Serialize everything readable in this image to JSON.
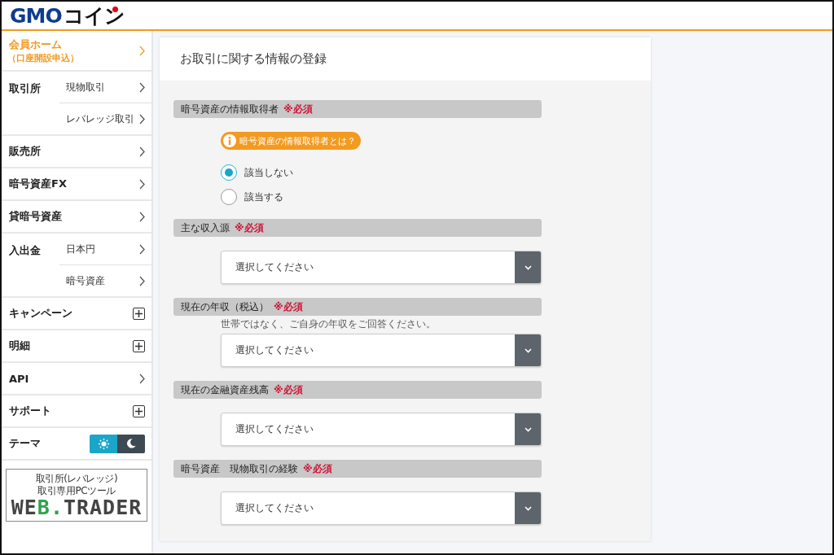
{
  "header": {
    "logo": {
      "latin": "GMO",
      "kana": "コイン"
    }
  },
  "sidebar": {
    "items": [
      {
        "kind": "link",
        "label": "会員ホーム",
        "sub": "（口座開設申込）",
        "selected": true
      },
      {
        "kind": "group",
        "label": "取引所",
        "children": [
          {
            "label": "現物取引"
          },
          {
            "label": "レバレッジ取引"
          }
        ]
      },
      {
        "kind": "link",
        "label": "販売所",
        "selected": false
      },
      {
        "kind": "link",
        "label": "暗号資産FX",
        "selected": false
      },
      {
        "kind": "link",
        "label": "貸暗号資産",
        "selected": false
      },
      {
        "kind": "group",
        "label": "入出金",
        "children": [
          {
            "label": "日本円"
          },
          {
            "label": "暗号資産"
          }
        ]
      },
      {
        "kind": "expand",
        "label": "キャンペーン",
        "expanded": false
      },
      {
        "kind": "expand",
        "label": "明細",
        "expanded": false
      },
      {
        "kind": "link",
        "label": "API",
        "selected": false
      },
      {
        "kind": "expand",
        "label": "サポート",
        "expanded": false
      },
      {
        "kind": "theme",
        "label": "テーマ",
        "options": [
          {
            "kind": "light",
            "selected": true
          },
          {
            "kind": "dark",
            "selected": false
          }
        ]
      }
    ],
    "banner": {
      "caption": "取引所(レバレッジ)取引専用PCツール",
      "title_parts": [
        {
          "text": "WE",
          "accent": false
        },
        {
          "text": "B.",
          "accent": true
        },
        {
          "text": "TRADER",
          "accent": false
        }
      ]
    }
  },
  "form": {
    "title": "お取引に関する情報の登録",
    "sections": [
      {
        "label": "暗号資産の情報取得者",
        "required": "※必須",
        "info": "暗号資産の情報取得者とは？",
        "options": [
          {
            "label": "該当しない",
            "selected": true
          },
          {
            "label": "該当する",
            "selected": false
          }
        ]
      },
      {
        "label": "主な収入源",
        "required": "※必須",
        "select": "選択してください"
      },
      {
        "label": "現在の年収（税込）",
        "required": "※必須",
        "hint": "世帯ではなく、ご自身の年収をご回答ください。",
        "select": "選択してください"
      },
      {
        "label": "現在の金融資産残高",
        "required": "※必須",
        "select": "選択してください"
      },
      {
        "label": "暗号資産　現物取引の経験",
        "required": "※必須",
        "select": "選択してください"
      }
    ]
  }
}
